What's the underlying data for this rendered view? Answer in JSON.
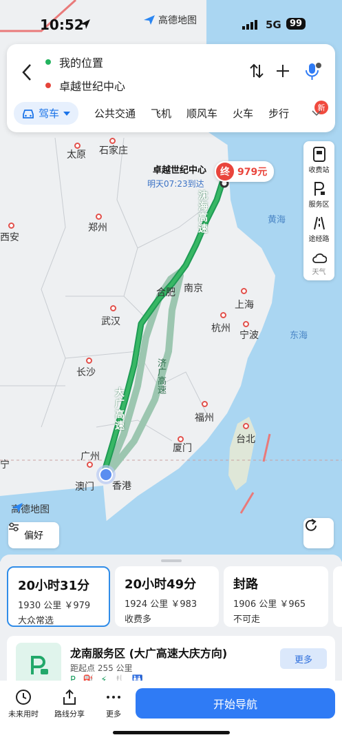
{
  "status": {
    "time": "10:52",
    "app": "高德地图",
    "network": "5G",
    "battery": "99"
  },
  "search": {
    "from": "我的位置",
    "to": "卓越世纪中心"
  },
  "modes": {
    "active": "驾车",
    "items": [
      "公共交通",
      "飞机",
      "顺风车",
      "火车",
      "步行"
    ],
    "new_badge": "新"
  },
  "tools": [
    {
      "label": "收费站",
      "icon": "toll-icon"
    },
    {
      "label": "服务区",
      "icon": "service-area-icon"
    },
    {
      "label": "途经路",
      "icon": "road-icon"
    },
    {
      "label": "天气",
      "icon": "weather-icon"
    }
  ],
  "map": {
    "destination": {
      "name": "卓越世纪中心",
      "eta": "明天07:23到达",
      "end_mark": "终",
      "price": "979元"
    },
    "cities": [
      "太原",
      "石家庄",
      "郑州",
      "西安",
      "合肥",
      "南京",
      "上海",
      "武汉",
      "杭州",
      "宁波",
      "长沙",
      "福州",
      "台北",
      "厦门",
      "广州",
      "澳门",
      "香港",
      "宁"
    ],
    "seas": [
      "黄海",
      "东海"
    ],
    "roads": {
      "shenhai": "沈海高速",
      "daguang": "大广高速",
      "jiguang": "济广高速"
    },
    "logo": "高德地图",
    "preference": "偏好"
  },
  "routes": [
    {
      "time": "20小时31分",
      "meta": "1930 公里 ￥979",
      "tag": "大众常选",
      "selected": true
    },
    {
      "time": "20小时49分",
      "meta": "1924 公里 ￥983",
      "tag": "收费多",
      "selected": false
    },
    {
      "time": "封路",
      "meta": "1906 公里 ￥965",
      "tag": "不可走",
      "selected": false
    }
  ],
  "service": {
    "name": "龙南服务区 (大广高速大庆方向)",
    "distance": "距起点 255 公里",
    "more": "更多"
  },
  "bottom": {
    "future": "未来用时",
    "share": "路线分享",
    "more": "更多",
    "start": "开始导航"
  }
}
